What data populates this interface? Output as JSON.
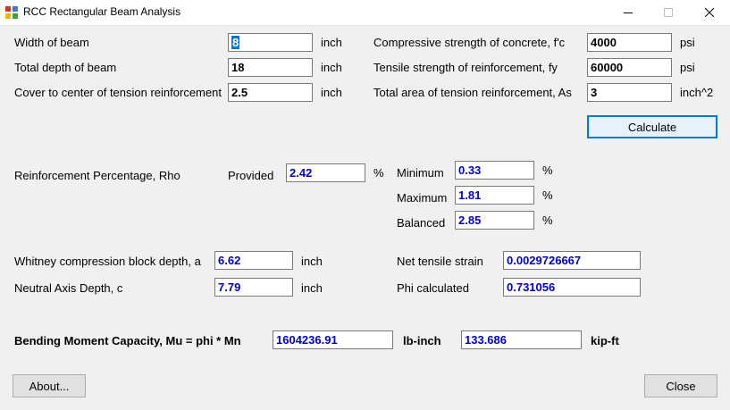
{
  "window": {
    "title": "RCC Rectangular Beam Analysis"
  },
  "inputs": {
    "width_label": "Width of beam",
    "width_value": "8",
    "width_unit": "inch",
    "depth_label": "Total depth of beam",
    "depth_value": "18",
    "depth_unit": "inch",
    "cover_label": "Cover to center of tension reinforcement",
    "cover_value": "2.5",
    "cover_unit": "inch",
    "fc_label": "Compressive strength of concrete, f'c",
    "fc_value": "4000",
    "fc_unit": "psi",
    "fy_label": "Tensile strength of reinforcement, fy",
    "fy_value": "60000",
    "fy_unit": "psi",
    "as_label": "Total area of tension reinforcement, As",
    "as_value": "3",
    "as_unit": "inch^2"
  },
  "calculate_label": "Calculate",
  "rho": {
    "label": "Reinforcement Percentage, Rho",
    "provided_label": "Provided",
    "provided_value": "2.42",
    "percent": "%",
    "minimum_label": "Minimum",
    "minimum_value": "0.33",
    "maximum_label": "Maximum",
    "maximum_value": "1.81",
    "balanced_label": "Balanced",
    "balanced_value": "2.85"
  },
  "results": {
    "a_label": "Whitney compression block depth, a",
    "a_value": "6.62",
    "a_unit": "inch",
    "c_label": "Neutral Axis Depth, c",
    "c_value": "7.79",
    "c_unit": "inch",
    "strain_label": "Net tensile strain",
    "strain_value": "0.0029726667",
    "phi_label": "Phi calculated",
    "phi_value": "0.731056"
  },
  "moment": {
    "label": "Bending Moment Capacity, Mu = phi * Mn",
    "lbinch_value": "1604236.91",
    "lbinch_unit": "lb-inch",
    "kipft_value": "133.686",
    "kipft_unit": "kip-ft"
  },
  "about_label": "About...",
  "close_label": "Close",
  "icons": [
    "app-icon",
    "minimize-icon",
    "maximize-icon",
    "close-icon"
  ]
}
